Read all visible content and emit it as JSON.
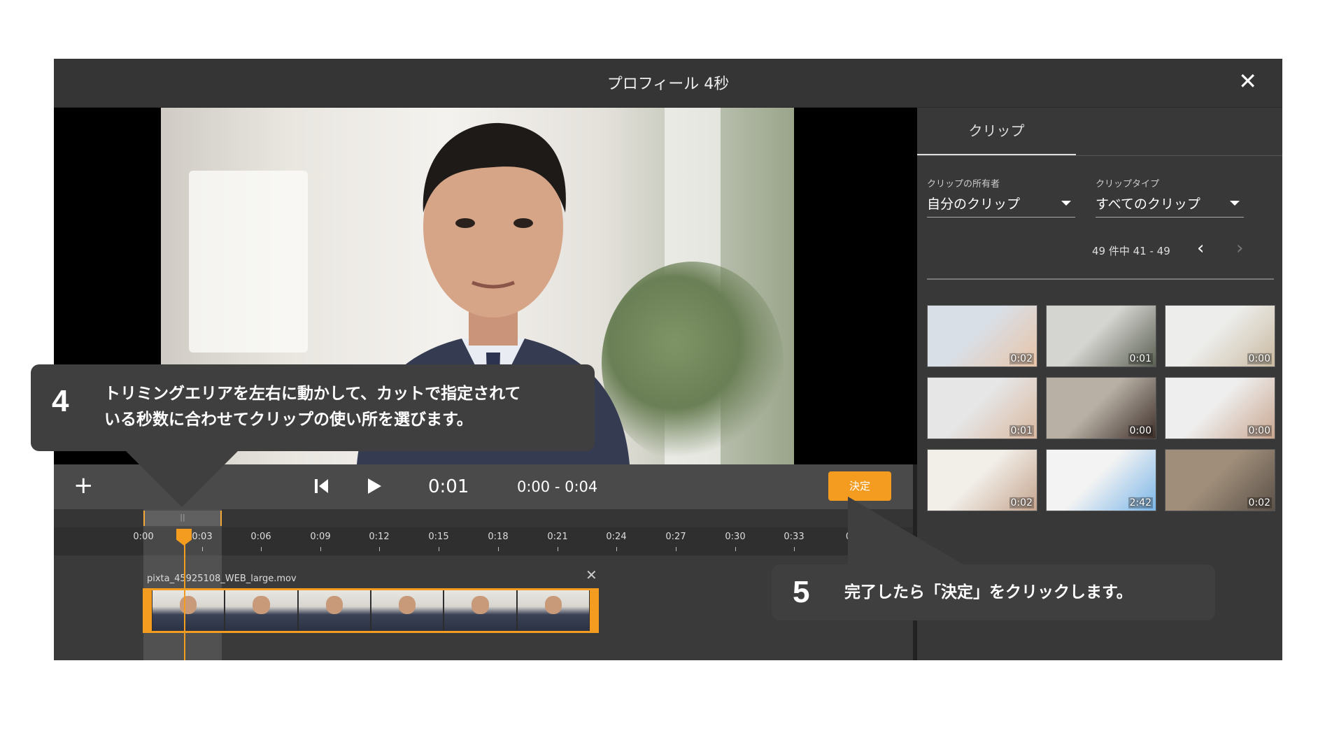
{
  "window": {
    "title": "プロフィール 4秒"
  },
  "player": {
    "current_time": "0:01",
    "range": "0:00 - 0:04",
    "decide_label": "決定",
    "ruler_ticks": [
      "0:00",
      "0:03",
      "0:06",
      "0:09",
      "0:12",
      "0:15",
      "0:18",
      "0:21",
      "0:24",
      "0:27",
      "0:30",
      "0:33",
      "0"
    ]
  },
  "timeline": {
    "clip_name": "pixta_45925108_WEB_large.mov"
  },
  "panel": {
    "tab": "クリップ",
    "owner_label": "クリップの所有者",
    "owner_value": "自分のクリップ",
    "type_label": "クリップタイプ",
    "type_value": "すべてのクリップ",
    "pager_text": "49 件中 41 - 49",
    "thumbs": [
      {
        "duration": "0:02",
        "colors": [
          "#d9dfe6",
          "#e8c3a7"
        ]
      },
      {
        "duration": "0:01",
        "colors": [
          "#d4d4d0",
          "#5a5f52"
        ]
      },
      {
        "duration": "0:00",
        "colors": [
          "#ededeb",
          "#c9b9a0"
        ]
      },
      {
        "duration": "0:01",
        "colors": [
          "#e6e6e6",
          "#d9b8a0"
        ]
      },
      {
        "duration": "0:00",
        "colors": [
          "#b8b0a5",
          "#3d2f2a"
        ]
      },
      {
        "duration": "0:00",
        "colors": [
          "#eeeeee",
          "#c9a690"
        ]
      },
      {
        "duration": "0:02",
        "colors": [
          "#f2efe9",
          "#c4a48e"
        ]
      },
      {
        "duration": "2:42",
        "colors": [
          "#f3f3f3",
          "#7ab6e8"
        ]
      },
      {
        "duration": "0:02",
        "colors": [
          "#a08e7a",
          "#5b5148"
        ]
      }
    ]
  },
  "callouts": {
    "step4": {
      "number": "4",
      "line1": "トリミングエリアを左右に動かして、カットで指定されて",
      "line2": "いる秒数に合わせてクリップの使い所を選びます。"
    },
    "step5": {
      "number": "5",
      "text": "完了したら「決定」をクリックします。"
    }
  }
}
